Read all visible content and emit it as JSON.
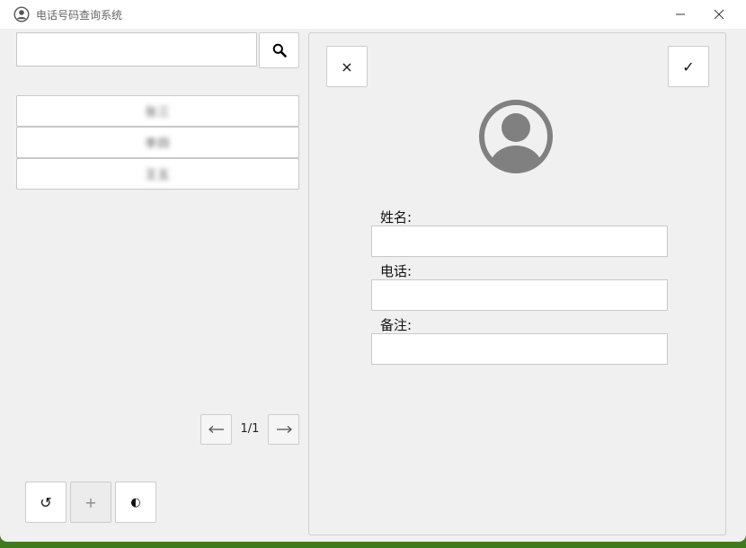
{
  "window": {
    "title": "电话号码查询系统"
  },
  "search": {
    "value": "",
    "placeholder": ""
  },
  "contacts": [
    {
      "name": "张三"
    },
    {
      "name": "李四"
    },
    {
      "name": "王五"
    }
  ],
  "pager": {
    "page_text": "1/1"
  },
  "bottom_buttons": {
    "refresh_glyph": "↺",
    "add_glyph": "+",
    "theme_glyph": "◐"
  },
  "detail": {
    "close_glyph": "×",
    "confirm_glyph": "✓",
    "fields": [
      {
        "label": "姓名:",
        "value": ""
      },
      {
        "label": "电话:",
        "value": ""
      },
      {
        "label": "备注:",
        "value": ""
      }
    ]
  },
  "colors": {
    "window_bg": "#f0f0f0",
    "titlebar_bg": "#ffffff",
    "avatar_gray": "#808080",
    "border": "#c8c8c8"
  },
  "icons": {
    "app": "user-circle-icon",
    "search": "search-icon",
    "prev": "arrow-left-icon",
    "next": "arrow-right-icon"
  }
}
